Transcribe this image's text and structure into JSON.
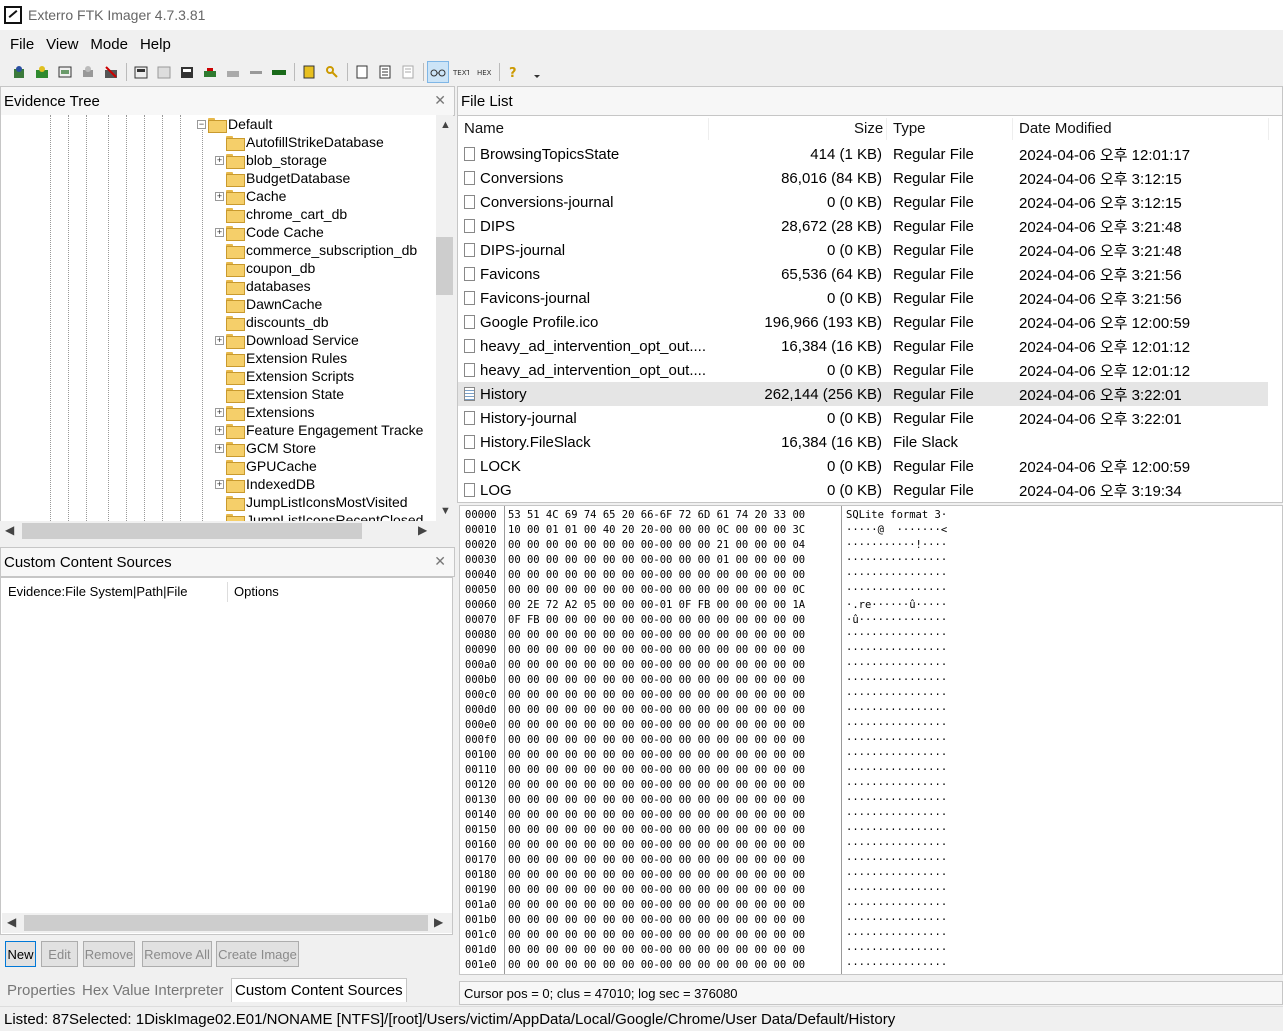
{
  "window": {
    "title": "Exterro FTK Imager 4.7.3.81"
  },
  "menu": [
    "File",
    "View",
    "Mode",
    "Help"
  ],
  "panels": {
    "evidence_tree_title": "Evidence Tree",
    "file_list_title": "File List",
    "custom_content_title": "Custom Content Sources",
    "close_glyph": "✕"
  },
  "tree": {
    "root": "Default",
    "items": [
      {
        "label": "AutofillStrikeDatabase",
        "expandable": false
      },
      {
        "label": "blob_storage",
        "expandable": true
      },
      {
        "label": "BudgetDatabase",
        "expandable": false
      },
      {
        "label": "Cache",
        "expandable": true
      },
      {
        "label": "chrome_cart_db",
        "expandable": false
      },
      {
        "label": "Code Cache",
        "expandable": true
      },
      {
        "label": "commerce_subscription_db",
        "expandable": false
      },
      {
        "label": "coupon_db",
        "expandable": false
      },
      {
        "label": "databases",
        "expandable": false
      },
      {
        "label": "DawnCache",
        "expandable": false
      },
      {
        "label": "discounts_db",
        "expandable": false
      },
      {
        "label": "Download Service",
        "expandable": true
      },
      {
        "label": "Extension Rules",
        "expandable": false
      },
      {
        "label": "Extension Scripts",
        "expandable": false
      },
      {
        "label": "Extension State",
        "expandable": false
      },
      {
        "label": "Extensions",
        "expandable": true
      },
      {
        "label": "Feature Engagement Tracke",
        "expandable": true
      },
      {
        "label": "GCM Store",
        "expandable": true
      },
      {
        "label": "GPUCache",
        "expandable": false
      },
      {
        "label": "IndexedDB",
        "expandable": true
      },
      {
        "label": "JumpListIconsMostVisited",
        "expandable": false
      },
      {
        "label": "JumpListIconsRecentClosed",
        "expandable": false
      }
    ]
  },
  "file_list": {
    "columns": [
      "Name",
      "Size",
      "Type",
      "Date Modified"
    ],
    "rows": [
      {
        "name": "BrowsingTopicsState",
        "size": "414 (1 KB)",
        "type": "Regular File",
        "date": "2024-04-06 오후 12:01:17",
        "icon": "file-icon"
      },
      {
        "name": "Conversions",
        "size": "86,016 (84 KB)",
        "type": "Regular File",
        "date": "2024-04-06 오후 3:12:15",
        "icon": "file-icon"
      },
      {
        "name": "Conversions-journal",
        "size": "0 (0 KB)",
        "type": "Regular File",
        "date": "2024-04-06 오후 3:12:15",
        "icon": "file-icon"
      },
      {
        "name": "DIPS",
        "size": "28,672 (28 KB)",
        "type": "Regular File",
        "date": "2024-04-06 오후 3:21:48",
        "icon": "file-icon"
      },
      {
        "name": "DIPS-journal",
        "size": "0 (0 KB)",
        "type": "Regular File",
        "date": "2024-04-06 오후 3:21:48",
        "icon": "file-icon"
      },
      {
        "name": "Favicons",
        "size": "65,536 (64 KB)",
        "type": "Regular File",
        "date": "2024-04-06 오후 3:21:56",
        "icon": "file-icon"
      },
      {
        "name": "Favicons-journal",
        "size": "0 (0 KB)",
        "type": "Regular File",
        "date": "2024-04-06 오후 3:21:56",
        "icon": "file-icon"
      },
      {
        "name": "Google Profile.ico",
        "size": "196,966 (193 KB)",
        "type": "Regular File",
        "date": "2024-04-06 오후 12:00:59",
        "icon": "file-icon"
      },
      {
        "name": "heavy_ad_intervention_opt_out....",
        "size": "16,384 (16 KB)",
        "type": "Regular File",
        "date": "2024-04-06 오후 12:01:12",
        "icon": "file-icon"
      },
      {
        "name": "heavy_ad_intervention_opt_out....",
        "size": "0 (0 KB)",
        "type": "Regular File",
        "date": "2024-04-06 오후 12:01:12",
        "icon": "file-icon"
      },
      {
        "name": "History",
        "size": "262,144 (256 KB)",
        "type": "Regular File",
        "date": "2024-04-06 오후 3:22:01",
        "icon": "sqlite-file-icon",
        "selected": true
      },
      {
        "name": "History-journal",
        "size": "0 (0 KB)",
        "type": "Regular File",
        "date": "2024-04-06 오후 3:22:01",
        "icon": "file-icon"
      },
      {
        "name": "History.FileSlack",
        "size": "16,384 (16 KB)",
        "type": "File Slack",
        "date": "",
        "icon": "file-icon"
      },
      {
        "name": "LOCK",
        "size": "0 (0 KB)",
        "type": "Regular File",
        "date": "2024-04-06 오후 12:00:59",
        "icon": "file-icon"
      },
      {
        "name": "LOG",
        "size": "0 (0 KB)",
        "type": "Regular File",
        "date": "2024-04-06 오후 3:19:34",
        "icon": "file-icon"
      }
    ]
  },
  "hex": {
    "rows": [
      {
        "off": "00000",
        "bytes": "53 51 4C 69 74 65 20 66-6F 72 6D 61 74 20 33 00",
        "ascii": "SQLite format 3·"
      },
      {
        "off": "00010",
        "bytes": "10 00 01 01 00 40 20 20-00 00 00 0C 00 00 00 3C",
        "ascii": "·····@  ·······<"
      },
      {
        "off": "00020",
        "bytes": "00 00 00 00 00 00 00 00-00 00 00 21 00 00 00 04",
        "ascii": "···········!····"
      },
      {
        "off": "00030",
        "bytes": "00 00 00 00 00 00 00 00-00 00 00 01 00 00 00 00",
        "ascii": "················"
      },
      {
        "off": "00040",
        "bytes": "00 00 00 00 00 00 00 00-00 00 00 00 00 00 00 00",
        "ascii": "················"
      },
      {
        "off": "00050",
        "bytes": "00 00 00 00 00 00 00 00-00 00 00 00 00 00 00 0C",
        "ascii": "················"
      },
      {
        "off": "00060",
        "bytes": "00 2E 72 A2 05 00 00 00-01 0F FB 00 00 00 00 1A",
        "ascii": "·.re······û·····"
      },
      {
        "off": "00070",
        "bytes": "0F FB 00 00 00 00 00 00-00 00 00 00 00 00 00 00",
        "ascii": "·û··············"
      },
      {
        "off": "00080",
        "bytes": "00 00 00 00 00 00 00 00-00 00 00 00 00 00 00 00",
        "ascii": "················"
      },
      {
        "off": "00090",
        "bytes": "00 00 00 00 00 00 00 00-00 00 00 00 00 00 00 00",
        "ascii": "················"
      },
      {
        "off": "000a0",
        "bytes": "00 00 00 00 00 00 00 00-00 00 00 00 00 00 00 00",
        "ascii": "················"
      },
      {
        "off": "000b0",
        "bytes": "00 00 00 00 00 00 00 00-00 00 00 00 00 00 00 00",
        "ascii": "················"
      },
      {
        "off": "000c0",
        "bytes": "00 00 00 00 00 00 00 00-00 00 00 00 00 00 00 00",
        "ascii": "················"
      },
      {
        "off": "000d0",
        "bytes": "00 00 00 00 00 00 00 00-00 00 00 00 00 00 00 00",
        "ascii": "················"
      },
      {
        "off": "000e0",
        "bytes": "00 00 00 00 00 00 00 00-00 00 00 00 00 00 00 00",
        "ascii": "················"
      },
      {
        "off": "000f0",
        "bytes": "00 00 00 00 00 00 00 00-00 00 00 00 00 00 00 00",
        "ascii": "················"
      },
      {
        "off": "00100",
        "bytes": "00 00 00 00 00 00 00 00-00 00 00 00 00 00 00 00",
        "ascii": "················"
      },
      {
        "off": "00110",
        "bytes": "00 00 00 00 00 00 00 00-00 00 00 00 00 00 00 00",
        "ascii": "················"
      },
      {
        "off": "00120",
        "bytes": "00 00 00 00 00 00 00 00-00 00 00 00 00 00 00 00",
        "ascii": "················"
      },
      {
        "off": "00130",
        "bytes": "00 00 00 00 00 00 00 00-00 00 00 00 00 00 00 00",
        "ascii": "················"
      },
      {
        "off": "00140",
        "bytes": "00 00 00 00 00 00 00 00-00 00 00 00 00 00 00 00",
        "ascii": "················"
      },
      {
        "off": "00150",
        "bytes": "00 00 00 00 00 00 00 00-00 00 00 00 00 00 00 00",
        "ascii": "················"
      },
      {
        "off": "00160",
        "bytes": "00 00 00 00 00 00 00 00-00 00 00 00 00 00 00 00",
        "ascii": "················"
      },
      {
        "off": "00170",
        "bytes": "00 00 00 00 00 00 00 00-00 00 00 00 00 00 00 00",
        "ascii": "················"
      },
      {
        "off": "00180",
        "bytes": "00 00 00 00 00 00 00 00-00 00 00 00 00 00 00 00",
        "ascii": "················"
      },
      {
        "off": "00190",
        "bytes": "00 00 00 00 00 00 00 00-00 00 00 00 00 00 00 00",
        "ascii": "················"
      },
      {
        "off": "001a0",
        "bytes": "00 00 00 00 00 00 00 00-00 00 00 00 00 00 00 00",
        "ascii": "················"
      },
      {
        "off": "001b0",
        "bytes": "00 00 00 00 00 00 00 00-00 00 00 00 00 00 00 00",
        "ascii": "················"
      },
      {
        "off": "001c0",
        "bytes": "00 00 00 00 00 00 00 00-00 00 00 00 00 00 00 00",
        "ascii": "················"
      },
      {
        "off": "001d0",
        "bytes": "00 00 00 00 00 00 00 00-00 00 00 00 00 00 00 00",
        "ascii": "················"
      },
      {
        "off": "001e0",
        "bytes": "00 00 00 00 00 00 00 00-00 00 00 00 00 00 00 00",
        "ascii": "················"
      }
    ],
    "cursor_info": "Cursor pos = 0; clus = 47010; log sec = 376080"
  },
  "custom_content": {
    "col1": "Evidence:File System|Path|File",
    "col2": "Options",
    "buttons": [
      "New",
      "Edit",
      "Remove",
      "Remove All",
      "Create Image"
    ]
  },
  "bottom_tabs": [
    "Properties",
    "Hex Value Interpreter",
    "Custom Content Sources"
  ],
  "status": "Listed: 87Selected: 1DiskImage02.E01/NONAME [NTFS]/[root]/Users/victim/AppData/Local/Google/Chrome/User Data/Default/History",
  "colors": {
    "selection": "#e5e5e5",
    "folder": "#f5cf6a",
    "active_tool": "#cce4f7"
  },
  "toolbar_icons": [
    "add-evidence-icon",
    "add-all-evidence-icon",
    "image-mounting-icon",
    "remove-evidence-icon",
    "remove-all-evidence-icon",
    "create-disk-image-icon",
    "export-disk-image-icon",
    "export-logical-image-icon",
    "add-to-custom-content-icon",
    "create-custom-content-image-icon",
    "decrypt-ad1-icon",
    "verify-drive-icon",
    "capture-memory-icon",
    "obtain-protected-files-icon",
    "detect-encryption-icon",
    "export-files-icon",
    "export-file-hash-list-icon",
    "export-directory-listing-icon",
    "auto-mode-icon",
    "text-mode-icon",
    "hex-mode-icon",
    "help-icon",
    "dropdown-icon"
  ]
}
